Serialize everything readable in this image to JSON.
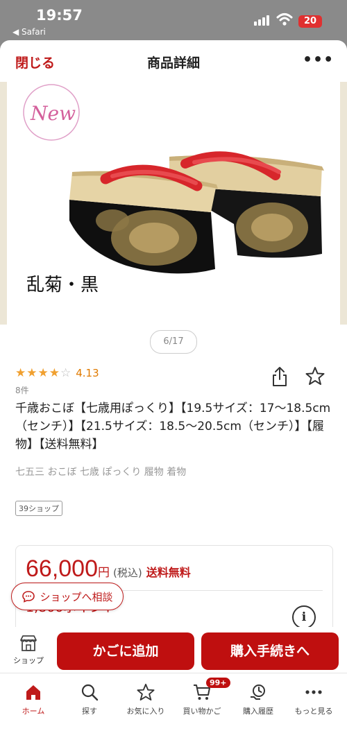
{
  "status_bar": {
    "time": "19:57",
    "back_app": "◀ Safari",
    "battery": "20"
  },
  "header": {
    "close_label": "閉じる",
    "title": "商品詳細",
    "more_label": "•••"
  },
  "gallery": {
    "caption": "乱菊・黒",
    "new_label": "New",
    "page_indicator": "6/17"
  },
  "product": {
    "stars": "★★★★",
    "star_empty": "☆",
    "rating": "4.13",
    "review_count": "8件",
    "title": "千歳おこぼ【七歳用ぽっくり】【19.5サイズ：17〜18.5cm（センチ）】【21.5サイズ：18.5〜20.5cm（センチ）】【履物】【送料無料】",
    "tags": "七五三 おこぼ 七歳 ぽっくり 履物 着物",
    "shop_badge": "39ショップ"
  },
  "price": {
    "amount": "66,000",
    "yen": "円",
    "tax": "(税込)",
    "shipping": "送料無料",
    "points": "1,800ポイント"
  },
  "consult_label": "ショップへ相談",
  "action_bar": {
    "shop_label": "ショップ",
    "cart_label": "かごに追加",
    "buy_label": "購入手続きへ"
  },
  "tabs": [
    {
      "label": "ホーム"
    },
    {
      "label": "探す"
    },
    {
      "label": "お気に入り"
    },
    {
      "label": "買い物かご",
      "badge": "99+"
    },
    {
      "label": "購入履歴"
    },
    {
      "label": "もっと見る"
    }
  ],
  "colors": {
    "brand": "#bf0f0f",
    "rating": "#f0a030"
  }
}
